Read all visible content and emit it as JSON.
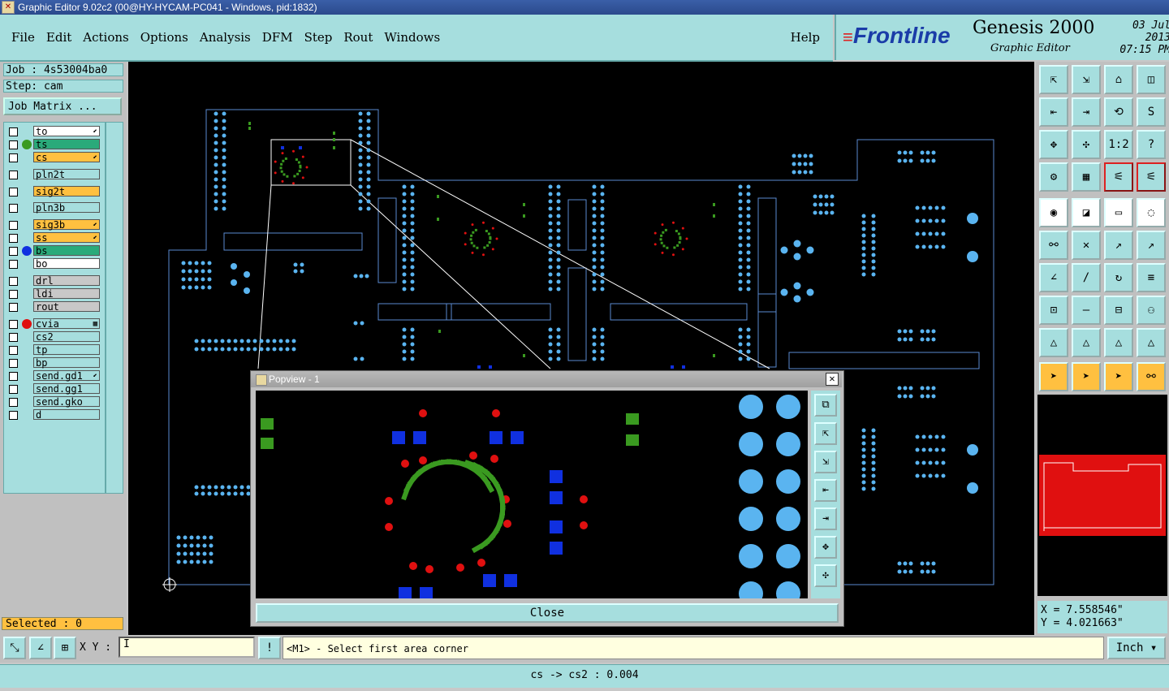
{
  "window": {
    "title": "Graphic Editor 9.02c2 (00@HY-HYCAM-PC041 - Windows, pid:1832)"
  },
  "menu": {
    "file": "File",
    "edit": "Edit",
    "actions": "Actions",
    "options": "Options",
    "analysis": "Analysis",
    "dfm": "DFM",
    "step": "Step",
    "rout": "Rout",
    "windows": "Windows",
    "help": "Help"
  },
  "brand": {
    "logo": "Frontline",
    "product": "Genesis 2000",
    "subtitle": "Graphic Editor",
    "date": "03 Jul 2013",
    "time": "07:15 PM"
  },
  "job": {
    "job_label": "Job : 4s53004ba0",
    "step_label": "Step: cam",
    "matrix_button": "Job Matrix ..."
  },
  "layers": [
    {
      "name": "to",
      "bg": "#ffffff",
      "dot": "",
      "mark": "⬋"
    },
    {
      "name": "ts",
      "bg": "#2aaa7a",
      "dot": "#3a9a20",
      "mark": ""
    },
    {
      "name": "cs",
      "bg": "#ffc040",
      "dot": "",
      "mark": "⬋"
    },
    {
      "name": "pln2t",
      "bg": "#a6dede",
      "dot": "",
      "mark": ""
    },
    {
      "name": "sig2t",
      "bg": "#ffc040",
      "dot": "",
      "mark": ""
    },
    {
      "name": "pln3b",
      "bg": "#a6dede",
      "dot": "",
      "mark": ""
    },
    {
      "name": "sig3b",
      "bg": "#ffc040",
      "dot": "",
      "mark": "⬋"
    },
    {
      "name": "ss",
      "bg": "#ffc040",
      "dot": "",
      "mark": "⬋"
    },
    {
      "name": "bs",
      "bg": "#2aaa7a",
      "dot": "#1030e0",
      "mark": ""
    },
    {
      "name": "bo",
      "bg": "#ffffff",
      "dot": "",
      "mark": ""
    },
    {
      "name": "drl",
      "bg": "#c8c8c8",
      "dot": "",
      "mark": ""
    },
    {
      "name": "ldi",
      "bg": "#c8c8c8",
      "dot": "",
      "mark": ""
    },
    {
      "name": "rout",
      "bg": "#c8c8c8",
      "dot": "",
      "mark": ""
    },
    {
      "name": "cvia",
      "bg": "#a6dede",
      "dot": "#e01010",
      "mark": "▦"
    },
    {
      "name": "cs2",
      "bg": "#a6dede",
      "dot": "",
      "mark": ""
    },
    {
      "name": "tp",
      "bg": "#a6dede",
      "dot": "",
      "mark": ""
    },
    {
      "name": "bp",
      "bg": "#a6dede",
      "dot": "",
      "mark": ""
    },
    {
      "name": "send.gd1",
      "bg": "#a6dede",
      "dot": "",
      "mark": "⬋"
    },
    {
      "name": "send.gg1",
      "bg": "#a6dede",
      "dot": "",
      "mark": ""
    },
    {
      "name": "send.gko",
      "bg": "#a6dede",
      "dot": "",
      "mark": ""
    },
    {
      "name": "d",
      "bg": "#a6dede",
      "dot": "",
      "mark": ""
    }
  ],
  "selected": "Selected : 0",
  "coords": {
    "x": "X = 7.558546\"",
    "y": "Y = 4.021663\""
  },
  "xy_label": "X Y :",
  "prompt": "<M1> - Select first area corner",
  "unit": "Inch",
  "status": "cs -> cs2 : 0.004",
  "popview": {
    "title": "Popview - 1",
    "close_label": "Close"
  },
  "colors": {
    "pad": "#5ab4f0",
    "green": "#3a9a20",
    "red": "#e01010",
    "blue": "#1030e0",
    "outline": "#5a8ad0"
  }
}
